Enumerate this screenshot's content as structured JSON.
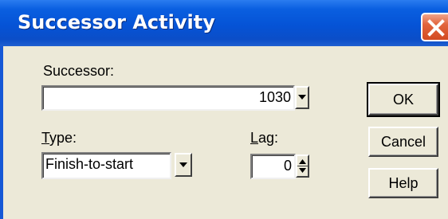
{
  "window": {
    "title": "Successor Activity"
  },
  "successor": {
    "label": "Successor:",
    "value": "1030"
  },
  "type": {
    "label_hotkey": "T",
    "label_rest": "ype:",
    "value": "Finish-to-start"
  },
  "lag": {
    "label_hotkey": "L",
    "label_rest": "ag:",
    "value": "0"
  },
  "buttons": {
    "ok": "OK",
    "cancel": "Cancel",
    "help": "Help"
  },
  "icons": {
    "close": "close-icon",
    "dropdown": "chevron-down-icon",
    "spin": "spin-updown-icon"
  },
  "colors": {
    "titlebar": "#0553d6",
    "close": "#d24a22",
    "dialog_bg": "#ece9d8"
  }
}
